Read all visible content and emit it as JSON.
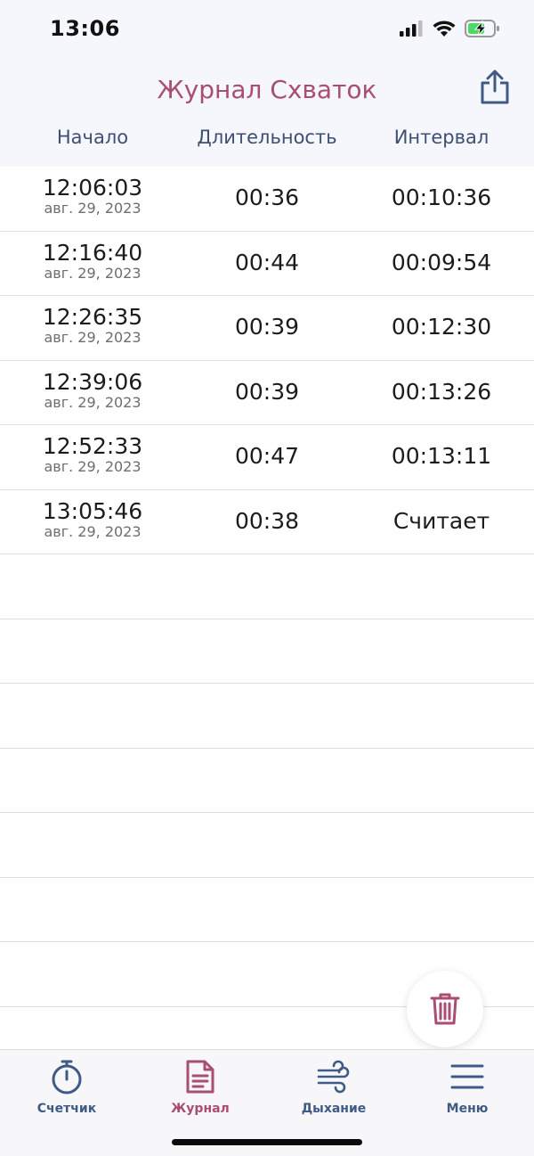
{
  "status_bar": {
    "time": "13:06"
  },
  "header": {
    "title": "Журнал Схваток",
    "columns": [
      "Начало",
      "Длительность",
      "Интервал"
    ]
  },
  "rows": [
    {
      "start_time": "12:06:03",
      "date": "авг. 29, 2023",
      "duration": "00:36",
      "interval": "00:10:36"
    },
    {
      "start_time": "12:16:40",
      "date": "авг. 29, 2023",
      "duration": "00:44",
      "interval": "00:09:54"
    },
    {
      "start_time": "12:26:35",
      "date": "авг. 29, 2023",
      "duration": "00:39",
      "interval": "00:12:30"
    },
    {
      "start_time": "12:39:06",
      "date": "авг. 29, 2023",
      "duration": "00:39",
      "interval": "00:13:26"
    },
    {
      "start_time": "12:52:33",
      "date": "авг. 29, 2023",
      "duration": "00:47",
      "interval": "00:13:11"
    },
    {
      "start_time": "13:05:46",
      "date": "авг. 29, 2023",
      "duration": "00:38",
      "interval": "Считает"
    }
  ],
  "tabs": [
    {
      "label": "Счетчик",
      "icon": "stopwatch-icon",
      "active": false
    },
    {
      "label": "Журнал",
      "icon": "document-icon",
      "active": true
    },
    {
      "label": "Дыхание",
      "icon": "wind-icon",
      "active": false
    },
    {
      "label": "Меню",
      "icon": "menu-icon",
      "active": false
    }
  ],
  "colors": {
    "accent": "#a94d72",
    "navy": "#3f5a85",
    "header_bg": "#f5f7fc"
  }
}
